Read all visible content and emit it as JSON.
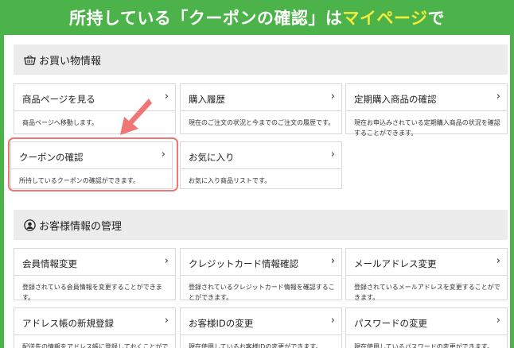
{
  "banner": {
    "text_main": "所持している「クーポンの確認」は",
    "text_highlight": "マイページ",
    "text_end": "で"
  },
  "colors": {
    "background": "#4cb24a",
    "highlight_text": "#f2ec3a",
    "arrow": "#f07575"
  },
  "section1": {
    "title": "お買い物情報",
    "icon": "shopping-basket-icon",
    "cards": [
      {
        "title": "商品ページを見る",
        "desc": "商品ページへ移動します。"
      },
      {
        "title": "購入履歴",
        "desc": "現在のご注文の状況と今までのご注文の履歴です。"
      },
      {
        "title": "定期購入商品の確認",
        "desc": "現在お申込みされている定期購入商品の状況を確認することができます。"
      },
      {
        "title": "クーポンの確認",
        "desc": "所持しているクーポンの確認ができます。"
      },
      {
        "title": "お気に入り",
        "desc": "お気に入り商品リストです。"
      }
    ]
  },
  "section2": {
    "title": "お客様情報の管理",
    "icon": "user-circle-icon",
    "cards": [
      {
        "title": "会員情報変更",
        "desc": "登録されている会員情報を変更することができます。"
      },
      {
        "title": "クレジットカード情報確認",
        "desc": "登録されているクレジットカード情報を確認することができます。"
      },
      {
        "title": "メールアドレス変更",
        "desc": "登録されているメールアドレスを変更することができます。"
      },
      {
        "title": "アドレス帳の新規登録",
        "desc": "配送先の情報をアドレス帳に登録しておくことができます"
      },
      {
        "title": "お客様IDの変更",
        "desc": "現在使用しているお客様IDの変更ができます。"
      },
      {
        "title": "パスワードの変更",
        "desc": "現在使用しているパスワードの変更ができます。"
      }
    ]
  },
  "chevron": "›"
}
